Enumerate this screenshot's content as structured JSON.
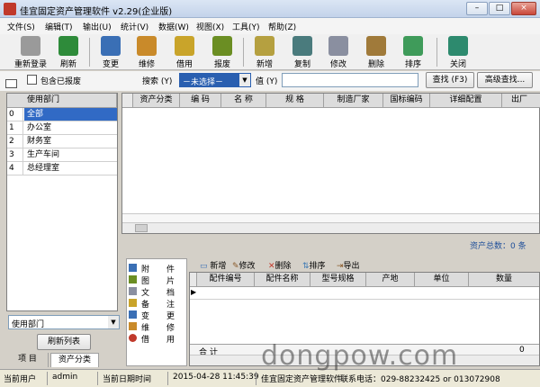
{
  "window": {
    "title": "佳宜固定资产管理软件 v2.29(企业版)",
    "min": "–",
    "max": "□",
    "close": "×"
  },
  "menu": [
    "文件(S)",
    "编辑(T)",
    "输出(U)",
    "统计(V)",
    "数据(W)",
    "视图(X)",
    "工具(Y)",
    "帮助(Z)"
  ],
  "toolbar": [
    {
      "label": "重新登录",
      "icon": "relogin-icon",
      "color": "#9a9a9a"
    },
    {
      "label": "刷新",
      "icon": "refresh-icon",
      "color": "#2e8b3a"
    },
    {
      "label": "变更",
      "icon": "change-icon",
      "color": "#3a6fb5"
    },
    {
      "label": "维修",
      "icon": "repair-icon",
      "color": "#c98a2a"
    },
    {
      "label": "借用",
      "icon": "borrow-icon",
      "color": "#c9a42a"
    },
    {
      "label": "报废",
      "icon": "scrap-icon",
      "color": "#6b8e23"
    },
    {
      "label": "新增",
      "icon": "add-icon",
      "color": "#b5a040"
    },
    {
      "label": "复制",
      "icon": "copy-icon",
      "color": "#4a7b7d"
    },
    {
      "label": "修改",
      "icon": "edit-icon",
      "color": "#8a8fa0"
    },
    {
      "label": "删除",
      "icon": "delete-icon",
      "color": "#a07a3a"
    },
    {
      "label": "排序",
      "icon": "sort-icon",
      "color": "#3f9b5a"
    },
    {
      "label": "关闭",
      "icon": "close-door-icon",
      "color": "#2d8a6e"
    }
  ],
  "search": {
    "include_scrapped": "包含已报废",
    "search_label": "搜索 (Y)",
    "search_value": "－未选择－",
    "value_label": "值 (Y)",
    "value_input": "",
    "find_button": "查找 (F3)",
    "advanced_button": "高级查找..."
  },
  "departments": {
    "header": "使用部门",
    "rows": [
      {
        "num": "0",
        "name": "全部"
      },
      {
        "num": "1",
        "name": "办公室"
      },
      {
        "num": "2",
        "name": "财务室"
      },
      {
        "num": "3",
        "name": "生产车间"
      },
      {
        "num": "4",
        "name": "总经理室"
      }
    ]
  },
  "left_bottom": {
    "filter": "使用部门",
    "refresh_button": "刷新列表"
  },
  "left_tabs": [
    "项  目",
    "资产分类"
  ],
  "asset_grid": {
    "columns": [
      "资产分类",
      "编  码",
      "名  称",
      "规  格",
      "制造厂家",
      "国标编码",
      "详细配置",
      "出厂"
    ],
    "total_label": "资产总数：0  条"
  },
  "detail_nav": [
    {
      "a": "附",
      "b": "件",
      "icon": "attachment-icon"
    },
    {
      "a": "图",
      "b": "片",
      "icon": "picture-icon"
    },
    {
      "a": "文",
      "b": "档",
      "icon": "document-icon"
    },
    {
      "a": "备",
      "b": "注",
      "icon": "note-icon"
    },
    {
      "a": "变",
      "b": "更",
      "icon": "change-icon"
    },
    {
      "a": "维",
      "b": "修",
      "icon": "repair-icon"
    },
    {
      "a": "借",
      "b": "用",
      "icon": "borrow-icon"
    }
  ],
  "parts_toolbar": [
    "新增",
    "修改",
    "删除",
    "排序",
    "导出"
  ],
  "parts_grid": {
    "columns": [
      "配件编号",
      "配件名称",
      "型号规格",
      "产地",
      "单位",
      "数量"
    ],
    "total_label": "合  计",
    "total_value": "0"
  },
  "status": {
    "user_label": "当前用户",
    "user": "admin",
    "date_label": "当前日期时间",
    "datetime": "2015-04-28 11:45:39",
    "company": "佳宜固定资产管理软件",
    "contact": "联系电话：029-88232425 or 013072908",
    "watermark": "dongpow.com"
  }
}
